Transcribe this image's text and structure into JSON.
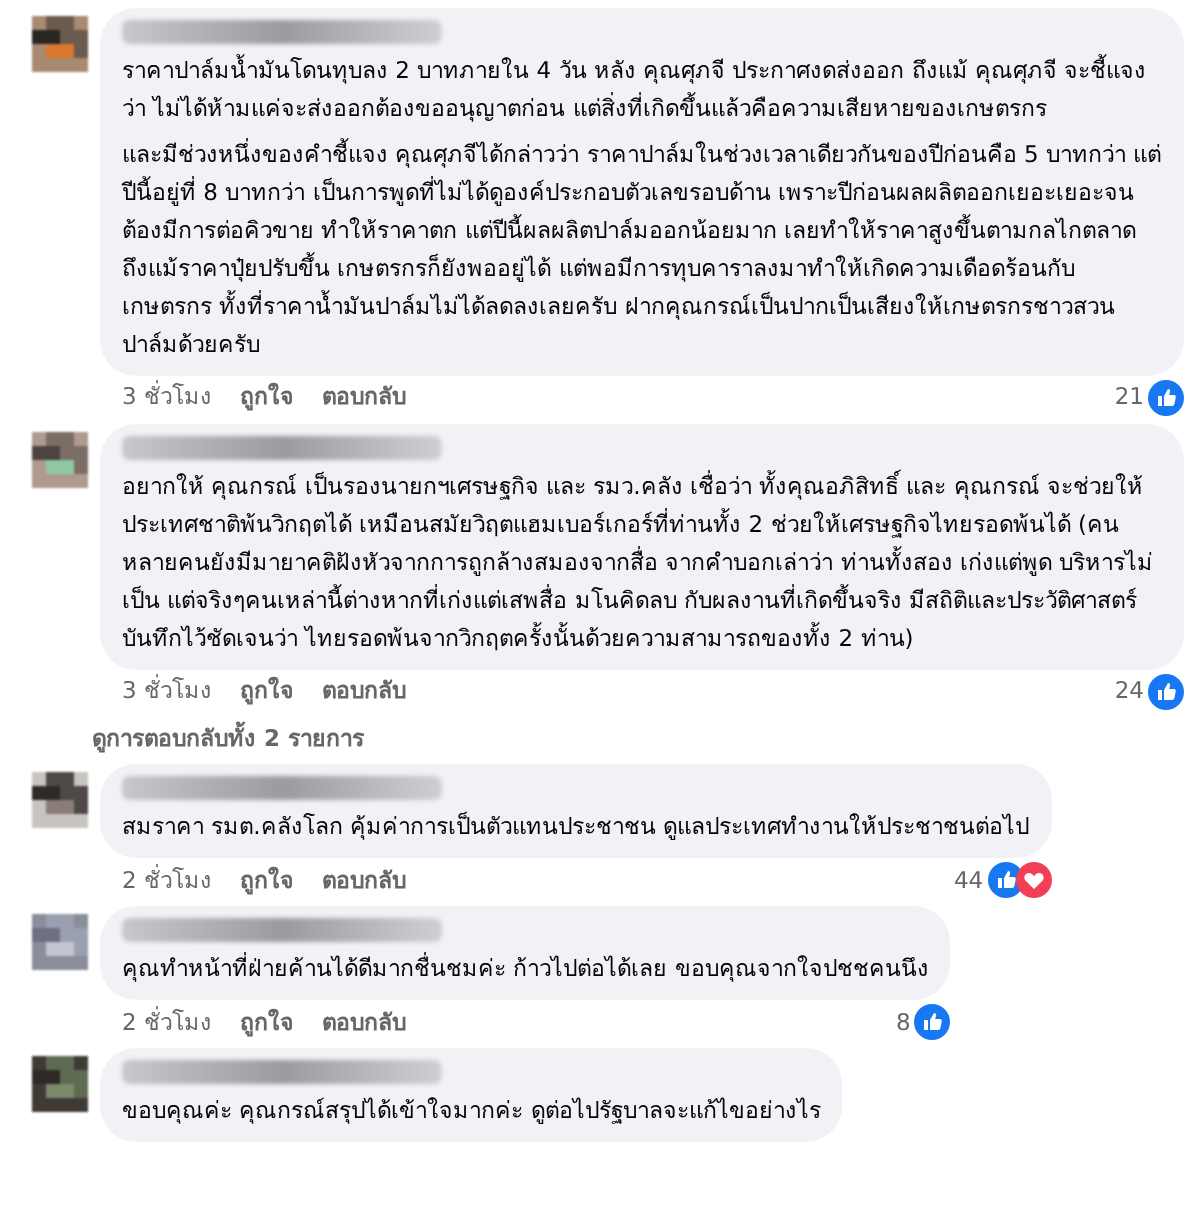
{
  "comments": [
    {
      "paragraphs": [
        "ราคาปาล์มน้ำมันโดนทุบลง 2 บาทภายใน 4 วัน หลัง คุณศุภจี ประกาศงดส่งออก ถึงแม้ คุณศุภจี จะชี้แจงว่า ไม่ได้ห้ามแค่จะส่งออกต้องขออนุญาตก่อน แต่สิ่งที่เกิดขึ้นแล้วคือความเสียหายของเกษตรกร",
        "และมีช่วงหนึ่งของคำชี้แจง คุณศุภจีได้กล่าวว่า ราคาปาล์มในช่วงเวลาเดียวกันของปีก่อนคือ 5 บาทกว่า แต่ปีนี้อยู่ที่ 8 บาทกว่า เป็นการพูดที่ไม่ได้ดูองค์ประกอบตัวเลขรอบด้าน เพราะปีก่อนผลผลิตออกเยอะเยอะจนต้องมีการต่อคิวขาย ทำให้ราคาตก แต่ปีนี้ผลผลิตปาล์มออกน้อยมาก เลยทำให้ราคาสูงขึ้นตามกลไกตลาด ถึงแม้ราคาปุ๋ยปรับขึ้น เกษตรกรก็ยังพออยู่ได้ แต่พอมีการทุบคาราลงมาทำให้เกิดความเดือดร้อนกับเกษตรกร ทั้งที่ราคาน้ำมันปาล์มไม่ได้ลดลงเลยครับ ฝากคุณกรณ์เป็นปากเป็นเสียงให้เกษตรกรชาวสวนปาล์มด้วยครับ"
      ],
      "time": "3 ชั่วโมง",
      "like_label": "ถูกใจ",
      "reply_label": "ตอบกลับ",
      "reaction_count": "21",
      "reactions": [
        {
          "kind": "like"
        }
      ]
    },
    {
      "paragraphs": [
        "อยากให้ คุณกรณ์ เป็นรองนายกฯเศรษฐกิจ และ รมว.คลัง เชื่อว่า ทั้งคุณอภิสิทธิ์ และ คุณกรณ์ จะช่วยให้ประเทศชาติพ้นวิกฤตได้ เหมือนสมัยวิฤตแฮมเบอร์เกอร์ที่ท่านทั้ง 2 ช่วยให้เศรษฐกิจไทยรอดพ้นได้ (คนหลายคนยังมีมายาคติฝังหัวจากการถูกล้างสมองจากสื่อ จากคำบอกเล่าว่า ท่านทั้งสอง เก่งแต่พูด บริหารไม่เป็น แต่จริงๆคนเหล่านี้ต่างหากที่เก่งแต่เสพสื่อ มโนคิดลบ กับผลงานที่เกิดขึ้นจริง มีสถิติและประวัติศาสตร์บันทึกไว้ชัดเจนว่า ไทยรอดพ้นจากวิกฤตครั้งนั้นด้วยความสามารถของทั้ง 2 ท่าน)"
      ],
      "time": "3 ชั่วโมง",
      "like_label": "ถูกใจ",
      "reply_label": "ตอบกลับ",
      "reaction_count": "24",
      "reactions": [
        {
          "kind": "like"
        }
      ],
      "replies_link": "ดูการตอบกลับทั้ง 2 รายการ"
    },
    {
      "paragraphs": [
        "สมราคา รมต.คลังโลก คุ้มค่าการเป็นตัวแทนประชาชน ดูแลประเทศทำงานให้ประชาชนต่อไป"
      ],
      "time": "2 ชั่วโมง",
      "like_label": "ถูกใจ",
      "reply_label": "ตอบกลับ",
      "reaction_count": "44",
      "reactions": [
        {
          "kind": "like"
        },
        {
          "kind": "love"
        }
      ]
    },
    {
      "paragraphs": [
        "คุณทำหน้าที่ฝ่ายค้านได้ดีมากชื่นชมค่ะ ก้าวไปต่อได้เลย ขอบคุณจากใจปชชคนนึง"
      ],
      "time": "2 ชั่วโมง",
      "like_label": "ถูกใจ",
      "reply_label": "ตอบกลับ",
      "reaction_count": "8",
      "reactions": [
        {
          "kind": "like"
        }
      ]
    },
    {
      "paragraphs": [
        "ขอบคุณค่ะ คุณกรณ์สรุปได้เข้าใจมากค่ะ ดูต่อไปรัฐบาลจะแก้ไขอย่างไร"
      ]
    }
  ]
}
